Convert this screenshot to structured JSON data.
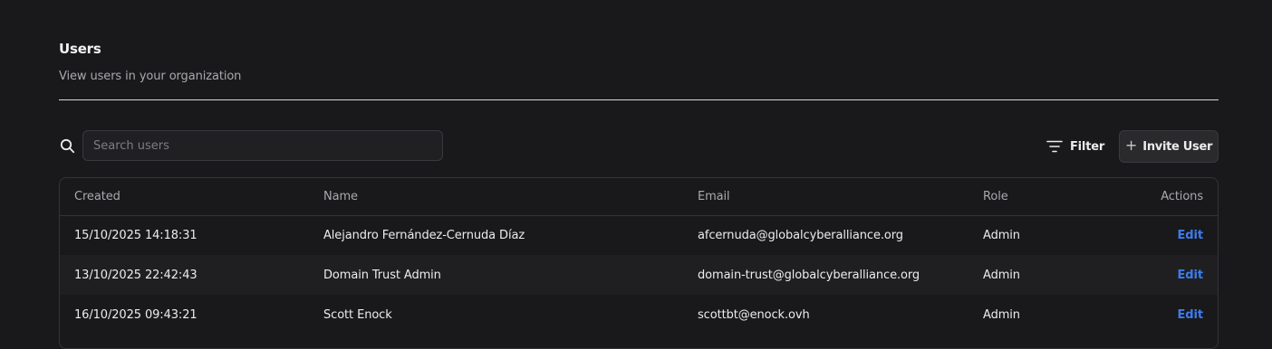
{
  "header": {
    "title": "Users",
    "subtitle": "View users in your organization"
  },
  "toolbar": {
    "search_placeholder": "Search users",
    "search_value": "",
    "filter_label": "Filter",
    "invite_label": "Invite User"
  },
  "table": {
    "columns": {
      "created": "Created",
      "name": "Name",
      "email": "Email",
      "role": "Role",
      "actions": "Actions"
    },
    "rows": [
      {
        "created": "15/10/2025 14:18:31",
        "name": "Alejandro Fernández-Cernuda Díaz",
        "email": "afcernuda@globalcyberalliance.org",
        "role": "Admin",
        "action": "Edit"
      },
      {
        "created": "13/10/2025 22:42:43",
        "name": "Domain Trust Admin",
        "email": "domain-trust@globalcyberalliance.org",
        "role": "Admin",
        "action": "Edit"
      },
      {
        "created": "16/10/2025 09:43:21",
        "name": "Scott Enock",
        "email": "scottbt@enock.ovh",
        "role": "Admin",
        "action": "Edit"
      }
    ]
  },
  "icons": {
    "search": "search-icon",
    "filter": "filter-icon",
    "invite": "plus-icon"
  },
  "colors": {
    "background": "#19191b",
    "link": "#3d7cf0",
    "alt_row": "#1f1f22"
  }
}
